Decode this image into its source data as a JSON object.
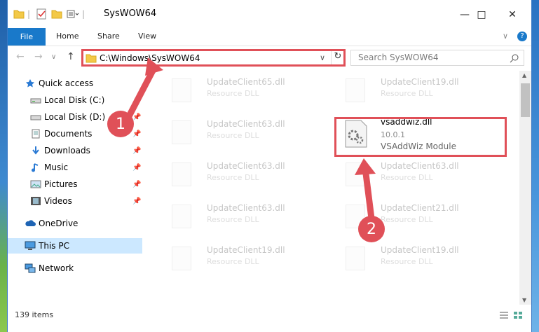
{
  "window": {
    "title": "SysWOW64",
    "minimize_label": "—",
    "maximize_label": "□",
    "close_label": "✕"
  },
  "ribbon": {
    "tabs": [
      "File",
      "Home",
      "Share",
      "View"
    ],
    "help_label": "?",
    "collapse_label": "∨"
  },
  "navigation": {
    "back_label": "←",
    "forward_label": "→",
    "dropdown_label": "∨",
    "up_label": "↑",
    "address": "C:\\Windows\\SysWOW64",
    "refresh_label": "↻",
    "search_placeholder": "Search SysWOW64"
  },
  "sidebar": {
    "items": [
      {
        "label": "Quick access",
        "icon": "star-icon"
      },
      {
        "label": "Local Disk (C:)",
        "icon": "drive-icon"
      },
      {
        "label": "Local Disk (D:)",
        "icon": "drive-icon"
      },
      {
        "label": "Documents",
        "icon": "documents-icon"
      },
      {
        "label": "Downloads",
        "icon": "download-icon"
      },
      {
        "label": "Music",
        "icon": "music-icon"
      },
      {
        "label": "Pictures",
        "icon": "pictures-icon"
      },
      {
        "label": "Videos",
        "icon": "videos-icon"
      },
      {
        "label": "OneDrive",
        "icon": "cloud-icon"
      },
      {
        "label": "This PC",
        "icon": "computer-icon"
      },
      {
        "label": "Network",
        "icon": "network-icon"
      }
    ]
  },
  "files": [
    {
      "name": "UpdateClient65.dll",
      "sub": "Resource DLL"
    },
    {
      "name": "UpdateClient19.dll",
      "sub": "Resource DLL"
    },
    {
      "name": "UpdateClient63.dll",
      "sub": "Resource DLL"
    },
    {
      "name": "vsaddwiz.dll",
      "sub": "10.0.1",
      "sub2": "VSAddWiz Module"
    },
    {
      "name": "UpdateClient63.dll",
      "sub": "Resource DLL"
    },
    {
      "name": "UpdateClient63.dll",
      "sub": "Resource DLL"
    },
    {
      "name": "UpdateClient63.dll",
      "sub": "Resource DLL"
    },
    {
      "name": "UpdateClient21.dll",
      "sub": "Resource DLL"
    },
    {
      "name": "UpdateClient19.dll",
      "sub": "Resource DLL"
    },
    {
      "name": "UpdateClient19.dll",
      "sub": "Resource DLL"
    }
  ],
  "status": {
    "item_count": "139 items"
  },
  "callouts": [
    "1",
    "2"
  ],
  "colors": {
    "accent": "#1979ca",
    "highlight": "#e05058",
    "selected": "#cce8ff"
  }
}
